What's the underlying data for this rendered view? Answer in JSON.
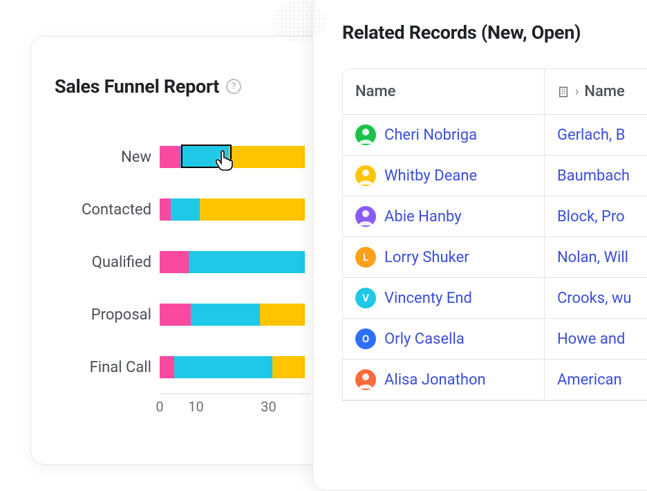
{
  "report": {
    "title": "Sales Funnel Report"
  },
  "chart_data": {
    "type": "bar",
    "orientation": "horizontal",
    "stacked": true,
    "categories": [
      "New",
      "Contacted",
      "Qualified",
      "Proposal",
      "Final Call"
    ],
    "series": [
      {
        "name": "pink",
        "color": "#f94aa0",
        "values": [
          6,
          3,
          8,
          9,
          4
        ]
      },
      {
        "name": "cyan",
        "color": "#1ec8e6",
        "values": [
          14,
          8,
          32,
          20,
          27
        ]
      },
      {
        "name": "yellow",
        "color": "#ffc400",
        "values": [
          22,
          29,
          0,
          13,
          9
        ]
      }
    ],
    "xlabel": "",
    "ylabel": "",
    "x_ticks": [
      0,
      10,
      30
    ],
    "xlim": [
      0,
      40
    ],
    "hovered": {
      "category": "New",
      "series": "cyan"
    }
  },
  "records": {
    "title": "Related Records (New, Open)",
    "columns": {
      "name": "Name",
      "company": "Name"
    },
    "rows": [
      {
        "person": "Cheri Nobriga",
        "avatar_bg": "#19c24a",
        "avatar_text": "",
        "company": "Gerlach, B"
      },
      {
        "person": "Whitby Deane",
        "avatar_bg": "#ffc400",
        "avatar_text": "",
        "company": "Baumbach"
      },
      {
        "person": "Abie Hanby",
        "avatar_bg": "#8a5cf6",
        "avatar_text": "",
        "company": "Block, Pro"
      },
      {
        "person": "Lorry Shuker",
        "avatar_bg": "#ff9f1a",
        "avatar_text": "L",
        "company": "Nolan, Will"
      },
      {
        "person": "Vincenty End",
        "avatar_bg": "#1ec8e6",
        "avatar_text": "V",
        "company": "Crooks, wu"
      },
      {
        "person": "Orly Casella",
        "avatar_bg": "#2f6fff",
        "avatar_text": "O",
        "company": "Howe and"
      },
      {
        "person": "Alisa Jonathon",
        "avatar_bg": "#ff6a3d",
        "avatar_text": "",
        "company": "American"
      }
    ]
  }
}
